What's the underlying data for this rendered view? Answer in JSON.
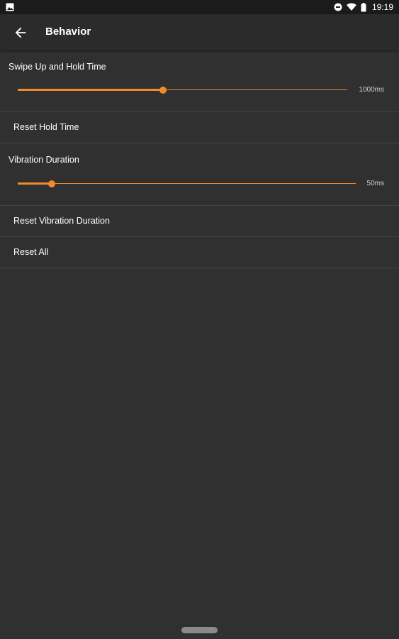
{
  "status_bar": {
    "time": "19:19",
    "icons": [
      "image-notification-icon",
      "do-not-disturb-icon",
      "wifi-icon",
      "battery-icon"
    ]
  },
  "app_bar": {
    "title": "Behavior",
    "back_icon": "arrow-back-icon"
  },
  "settings": {
    "hold_time": {
      "label": "Swipe Up and Hold Time",
      "value_text": "1000ms",
      "fraction": 0.44
    },
    "reset_hold_time": "Reset Hold Time",
    "vibration": {
      "label": "Vibration Duration",
      "value_text": "50ms",
      "fraction": 0.1
    },
    "reset_vibration": "Reset Vibration Duration",
    "reset_all": "Reset All"
  },
  "colors": {
    "accent": "#f28a2c",
    "background": "#303030",
    "app_bar": "#2b2b2b",
    "status_bar": "#1b1b1b"
  }
}
